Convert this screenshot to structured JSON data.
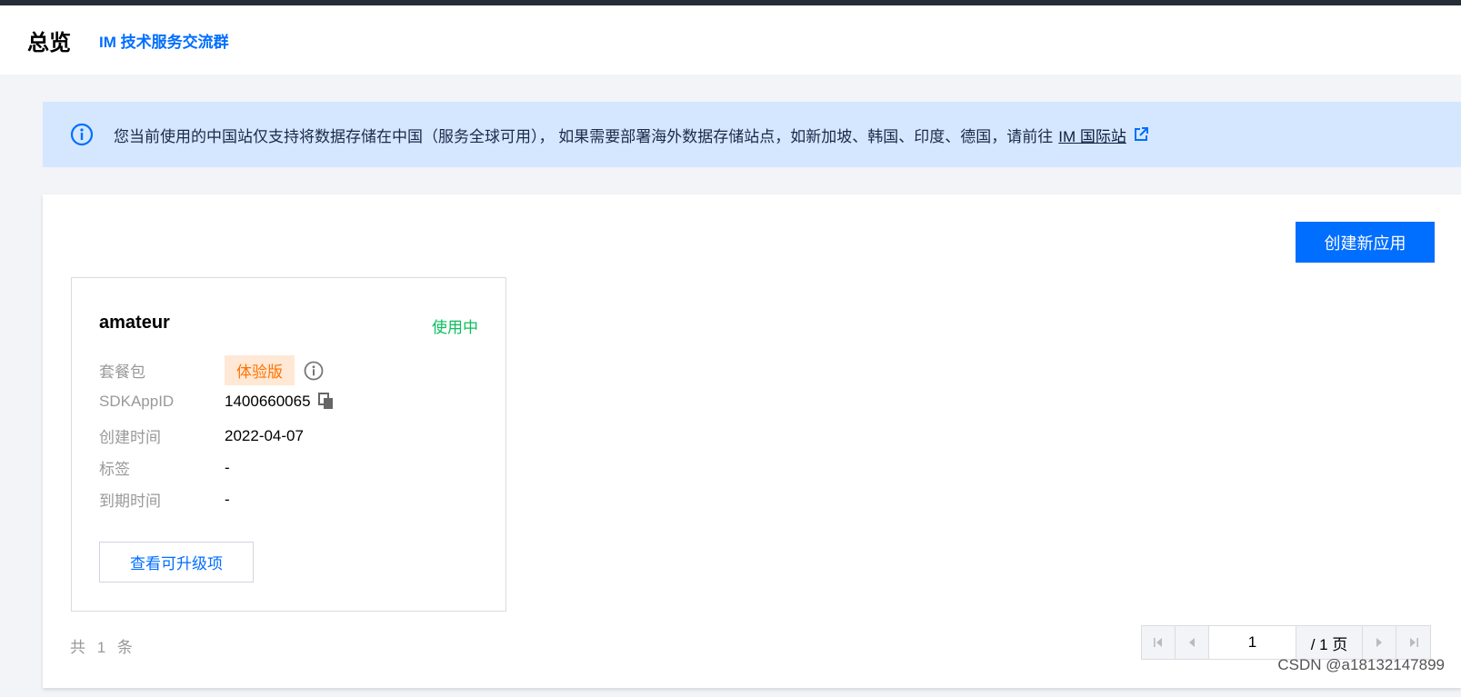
{
  "header": {
    "title": "总览",
    "link": "IM 技术服务交流群"
  },
  "notice": {
    "text": "您当前使用的中国站仅支持将数据存储在中国（服务全球可用）， 如果需要部署海外数据存储站点，如新加坡、韩国、印度、德国，请前往",
    "link": "IM 国际站",
    "icon": "info-icon",
    "link_icon": "external-link-icon"
  },
  "toolbar": {
    "create_label": "创建新应用"
  },
  "app": {
    "name": "amateur",
    "status": "使用中",
    "fields": {
      "plan_label": "套餐包",
      "plan_value": "体验版",
      "sdk_label": "SDKAppID",
      "sdk_value": "1400660065",
      "created_label": "创建时间",
      "created_value": "2022-04-07",
      "tags_label": "标签",
      "tags_value": "-",
      "expire_label": "到期时间",
      "expire_value": "-"
    },
    "upgrade_label": "查看可升级项"
  },
  "pagination": {
    "total_text": "共 1 条",
    "current_page": "1",
    "total_pages": "/ 1 页"
  },
  "watermark": "CSDN @a18132147899",
  "colors": {
    "accent": "#006eff",
    "status_green": "#0abf5b",
    "tag_orange": "#ff7200",
    "notice_bg": "#d5e7ff"
  }
}
